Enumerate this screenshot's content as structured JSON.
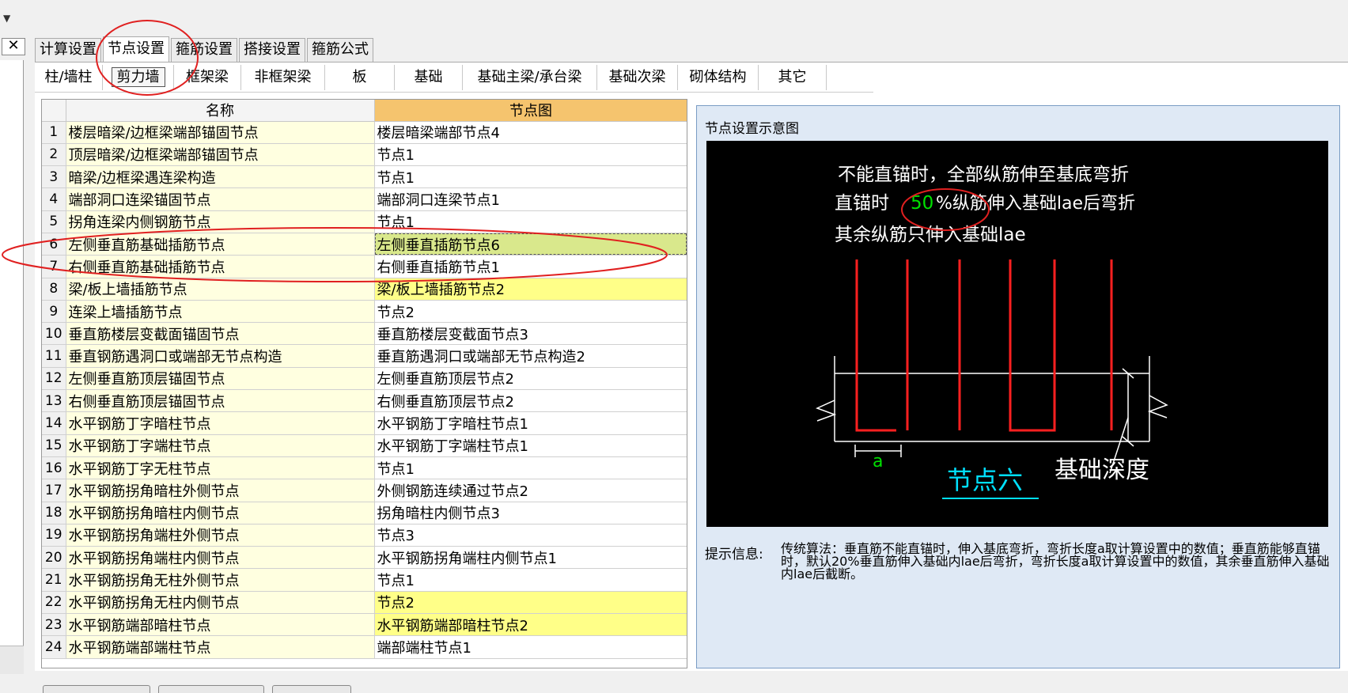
{
  "main_tabs": [
    "计算设置",
    "节点设置",
    "箍筋设置",
    "搭接设置",
    "箍筋公式"
  ],
  "sub_tabs": [
    "柱/墙柱",
    "剪力墙",
    "框架梁",
    "非框架梁",
    "板",
    "基础",
    "基础主梁/承台梁",
    "基础次梁",
    "砌体结构",
    "其它"
  ],
  "close_glyph": "✕",
  "table": {
    "headers": [
      "名称",
      "节点图"
    ],
    "rows": [
      {
        "idx": "1",
        "name": "楼层暗梁/边框梁端部锚固节点",
        "node": "楼层暗梁端部节点4"
      },
      {
        "idx": "2",
        "name": "顶层暗梁/边框梁端部锚固节点",
        "node": "节点1"
      },
      {
        "idx": "3",
        "name": "暗梁/边框梁遇连梁构造",
        "node": "节点1"
      },
      {
        "idx": "4",
        "name": "端部洞口连梁锚固节点",
        "node": "端部洞口连梁节点1"
      },
      {
        "idx": "5",
        "name": "拐角连梁内侧钢筋节点",
        "node": "节点1"
      },
      {
        "idx": "6",
        "name": "左侧垂直筋基础插筋节点",
        "node": "左侧垂直插筋节点6"
      },
      {
        "idx": "7",
        "name": "右侧垂直筋基础插筋节点",
        "node": "右侧垂直插筋节点1"
      },
      {
        "idx": "8",
        "name": "梁/板上墙插筋节点",
        "node": "梁/板上墙插筋节点2"
      },
      {
        "idx": "9",
        "name": "连梁上墙插筋节点",
        "node": "节点2"
      },
      {
        "idx": "10",
        "name": "垂直筋楼层变截面锚固节点",
        "node": "垂直筋楼层变截面节点3"
      },
      {
        "idx": "11",
        "name": "垂直钢筋遇洞口或端部无节点构造",
        "node": "垂直筋遇洞口或端部无节点构造2"
      },
      {
        "idx": "12",
        "name": "左侧垂直筋顶层锚固节点",
        "node": "左侧垂直筋顶层节点2"
      },
      {
        "idx": "13",
        "name": "右侧垂直筋顶层锚固节点",
        "node": "右侧垂直筋顶层节点2"
      },
      {
        "idx": "14",
        "name": "水平钢筋丁字暗柱节点",
        "node": "水平钢筋丁字暗柱节点1"
      },
      {
        "idx": "15",
        "name": "水平钢筋丁字端柱节点",
        "node": "水平钢筋丁字端柱节点1"
      },
      {
        "idx": "16",
        "name": "水平钢筋丁字无柱节点",
        "node": "节点1"
      },
      {
        "idx": "17",
        "name": "水平钢筋拐角暗柱外侧节点",
        "node": "外侧钢筋连续通过节点2"
      },
      {
        "idx": "18",
        "name": "水平钢筋拐角暗柱内侧节点",
        "node": "拐角暗柱内侧节点3"
      },
      {
        "idx": "19",
        "name": "水平钢筋拐角端柱外侧节点",
        "node": "节点3"
      },
      {
        "idx": "20",
        "name": "水平钢筋拐角端柱内侧节点",
        "node": "水平钢筋拐角端柱内侧节点1"
      },
      {
        "idx": "21",
        "name": "水平钢筋拐角无柱外侧节点",
        "node": "节点1"
      },
      {
        "idx": "22",
        "name": "水平钢筋拐角无柱内侧节点",
        "node": "节点2"
      },
      {
        "idx": "23",
        "name": "水平钢筋端部暗柱节点",
        "node": "水平钢筋端部暗柱节点2"
      },
      {
        "idx": "24",
        "name": "水平钢筋端部端柱节点",
        "node": "端部端柱节点1"
      }
    ]
  },
  "diagram": {
    "panel_title": "节点设置示意图",
    "line1": "不能直锚时，全部纵筋伸至基底弯折",
    "line2_prefix": "直锚时",
    "line2_value": "50",
    "line2_suffix": "%纵筋伸入基础lae后弯折",
    "line3": "其余纵筋只伸入基础lae",
    "dim_label": "a",
    "node_title": "节点六",
    "depth_label": "基础深度"
  },
  "hint": {
    "label": "提示信息:",
    "text": "传统算法：垂直筋不能直锚时，伸入基底弯折，弯折长度a取计算设置中的数值；垂直筋能够直锚时，默认20%垂直筋伸入基础内lae后弯折，弯折长度a取计算设置中的数值，其余垂直筋伸入基础内lae后截断。"
  },
  "colors": {
    "header_orange": "#f5c46e",
    "name_cell": "#ffffe0",
    "highlight_yellow": "#ffff88",
    "selected_cell": "#d9e88c",
    "rebar_red": "#ff2020",
    "value_green": "#00e000",
    "title_cyan": "#00e0ff",
    "annotation_red": "#e02020"
  }
}
